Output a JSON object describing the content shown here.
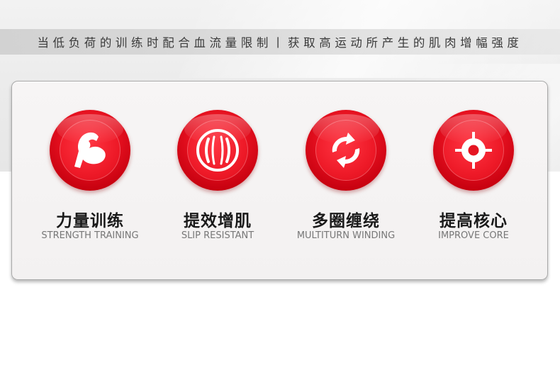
{
  "header": {
    "slogan": "当低负荷的训练时配合血流量限制丨获取高运动所产生的肌肉增幅强度"
  },
  "features": [
    {
      "title": "力量训练",
      "subtitle": "STRENGTH TRAINING",
      "icon": "bicep-arm-icon"
    },
    {
      "title": "提效增肌",
      "subtitle": "SLIP RESISTANT",
      "icon": "muscle-band-icon"
    },
    {
      "title": "多圈缠绕",
      "subtitle": "MULTITURN WINDING",
      "icon": "refresh-arrows-icon"
    },
    {
      "title": "提高核心",
      "subtitle": "IMPROVE CORE",
      "icon": "crosshair-target-icon"
    }
  ],
  "colors": {
    "accent_red": "#e30f1e",
    "title_text": "#1a1a1a",
    "subtitle_text": "#777777",
    "slogan_text": "#3a3a3a"
  }
}
